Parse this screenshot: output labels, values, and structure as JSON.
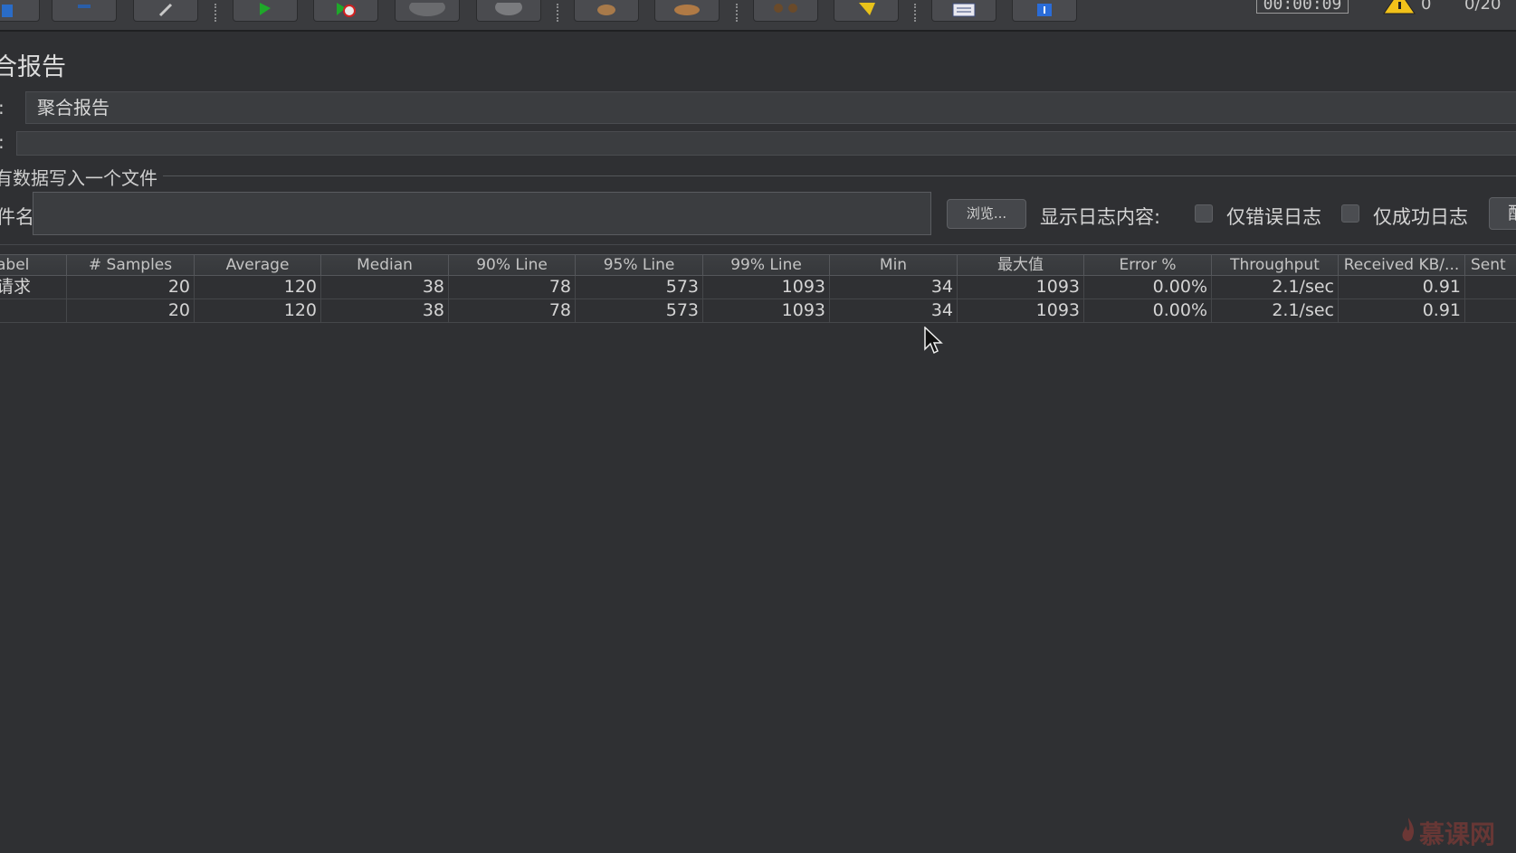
{
  "toolbar": {
    "buttons": [
      {
        "name": "new-icon"
      },
      {
        "name": "templates-icon"
      },
      {
        "name": "edit-icon"
      },
      {
        "name": "start-icon"
      },
      {
        "name": "start-no-pause-icon"
      },
      {
        "name": "stop-icon"
      },
      {
        "name": "shutdown-icon"
      },
      {
        "name": "clear-icon"
      },
      {
        "name": "clear-all-icon"
      },
      {
        "name": "search-icon"
      },
      {
        "name": "reset-search-icon"
      },
      {
        "name": "function-helper-icon"
      },
      {
        "name": "help-icon"
      }
    ],
    "timer": "00:00:09",
    "warning_count": "0",
    "threads": "0/20"
  },
  "panel": {
    "title": "合报告",
    "name_label": ":",
    "name_value": "聚合报告",
    "comment_label": ":",
    "comment_value": "",
    "file_group_title": "有数据写入一个文件",
    "filename_label": "件名",
    "filename_value": "",
    "browse_label": "浏览...",
    "log_content_label": "显示日志内容:",
    "errors_only_label": "仅错误日志",
    "success_only_label": "仅成功日志",
    "config_label": "配"
  },
  "table": {
    "headers": [
      "abel",
      "# Samples",
      "Average",
      "Median",
      "90% Line",
      "95% Line",
      "99% Line",
      "Min",
      "最大值",
      "Error %",
      "Throughput",
      "Received KB/...",
      "Sent"
    ],
    "rows": [
      [
        "请求",
        "20",
        "120",
        "38",
        "78",
        "573",
        "1093",
        "34",
        "1093",
        "0.00%",
        "2.1/sec",
        "0.91",
        ""
      ],
      [
        "",
        "20",
        "120",
        "38",
        "78",
        "573",
        "1093",
        "34",
        "1093",
        "0.00%",
        "2.1/sec",
        "0.91",
        ""
      ]
    ]
  },
  "watermark": "慕课网",
  "colors": {
    "background": "#2f3033",
    "toolbar": "#3a3b3e",
    "text": "#d4d4d4",
    "watermark": "#7a3a36"
  }
}
